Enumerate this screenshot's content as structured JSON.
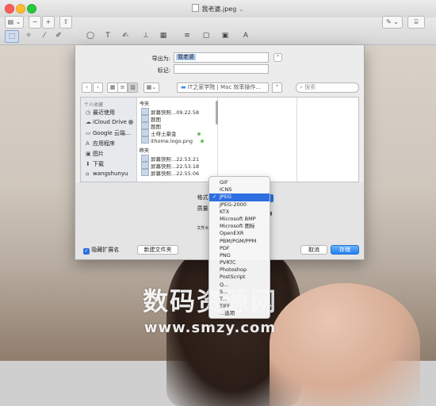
{
  "window": {
    "title": "我老婆.jpeg",
    "title_arrow": "⌄"
  },
  "toolbar": {
    "sidebar_btn": "▤ ⌄",
    "zoom_out_btn": "−",
    "zoom_in_btn": "+",
    "share_btn": "⇧",
    "pen_btn": "✎ ⌄",
    "toolbox_btn": "⌸",
    "tools": [
      "⬚",
      "✧",
      "⁄",
      "✐",
      "◯",
      "T",
      "✍",
      "⟂",
      "▦",
      "≡",
      "▢",
      "▣",
      "A"
    ]
  },
  "export": {
    "save_as_label": "导出为:",
    "save_as_value": "我老婆",
    "tags_label": "标记:",
    "tags_value": "",
    "location": "IT之家学院 | Mac 效率操作…",
    "search_placeholder": "搜索"
  },
  "sidebar": {
    "heading": "个人收藏",
    "items": [
      {
        "icon": "recents-icon",
        "glyph": "◷",
        "label": "最近使用"
      },
      {
        "icon": "icloud-icon",
        "glyph": "☁",
        "label": "iCloud Drive"
      },
      {
        "icon": "folder-icon",
        "glyph": "▭",
        "label": "Google 云端..."
      },
      {
        "icon": "applications-icon",
        "glyph": "A",
        "label": "应用程序"
      },
      {
        "icon": "pictures-icon",
        "glyph": "▣",
        "label": "图片"
      },
      {
        "icon": "downloads-icon",
        "glyph": "⬇",
        "label": "下载"
      },
      {
        "icon": "home-icon",
        "glyph": "⌂",
        "label": "wangshunyu"
      }
    ]
  },
  "files": {
    "today_label": "今天",
    "today": [
      "屏幕快照...09.22.58",
      "题图",
      "题图",
      "土呀土豪金",
      "ithome.logo.png"
    ],
    "yesterday_label": "昨天",
    "yesterday": [
      "屏幕快照...22.53.21",
      "屏幕快照...22.53.18",
      "屏幕快照...22.55.06"
    ]
  },
  "options": {
    "format_label": "格式:",
    "quality_label": "质量:",
    "filesize_label": "文件大小:",
    "hide_ext_label": "隐藏扩展名",
    "hide_ext_checked": true,
    "new_folder_btn": "新建文件夹",
    "cancel_btn": "取消",
    "save_btn": "存储"
  },
  "format_menu": {
    "items": [
      "GIF",
      "ICNS",
      "JPEG",
      "JPEG-2000",
      "KTX",
      "Microsoft BMP",
      "Microsoft 图标",
      "OpenEXR",
      "PBM/PGM/PPM",
      "PDF",
      "PNG",
      "PVRTC",
      "Photoshop",
      "PostScript",
      "Q...",
      "S...",
      "T...",
      "TIFF",
      "...选项"
    ],
    "selected": "JPEG"
  },
  "watermark": {
    "line1": "数码资源网",
    "line2": "www.smzy.com"
  },
  "colors": {
    "accent": "#2d6fe0",
    "save_button": "#1f7ff0"
  }
}
